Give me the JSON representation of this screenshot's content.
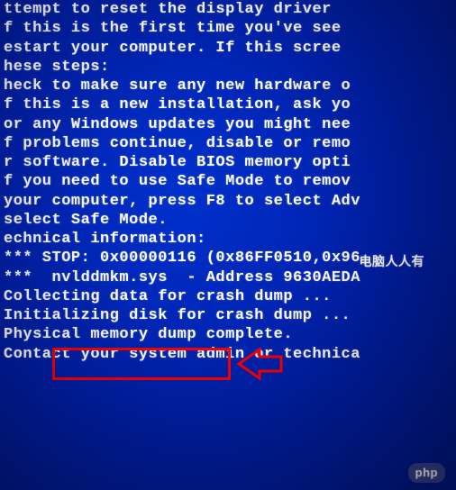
{
  "bsod": {
    "lines": [
      "ttempt to reset the display driver",
      "",
      "f this is the first time you've see",
      "estart your computer. If this scree",
      "hese steps:",
      "",
      "heck to make sure any new hardware o",
      "f this is a new installation, ask yo",
      "or any Windows updates you might nee",
      "",
      "f problems continue, disable or remo",
      "r software. Disable BIOS memory opti",
      "f you need to use Safe Mode to remov",
      "your computer, press F8 to select Adv",
      "select Safe Mode.",
      "",
      "echnical information:",
      "",
      "*** STOP: 0x00000116 (0x86FF0510,0x96",
      "",
      "",
      "***  nvlddmkm.sys  - Address 9630AEDA ",
      "",
      "",
      "Collecting data for crash dump ...",
      "Initializing disk for crash dump ...",
      "Physical memory dump complete.",
      "Contact your system admin or technica"
    ]
  },
  "annotations": {
    "highlighted_file": "nvlddmkm.sys",
    "box_color": "#ff0000",
    "arrow_color": "#ff0000"
  },
  "watermark": {
    "text_cn": "电脑人人有",
    "php_logo": "php"
  }
}
